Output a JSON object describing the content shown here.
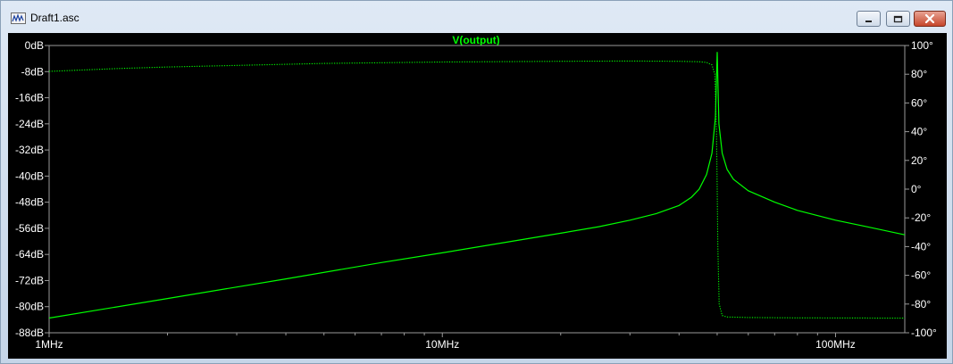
{
  "window": {
    "title": "Draft1.asc"
  },
  "colors": {
    "trace": "#00ff00",
    "background": "#000000",
    "text": "#ffffff"
  },
  "icons": {
    "app": "waveform-icon",
    "minimize": "minimize-icon",
    "maximize": "maximize-icon",
    "close": "close-icon"
  },
  "chart_data": {
    "type": "line",
    "title": "V(output)",
    "x_scale": "log",
    "x_unit": "Hz",
    "xlim": [
      1000000,
      150000000
    ],
    "x_ticks": [
      {
        "value": 1000000,
        "label": "1MHz"
      },
      {
        "value": 10000000,
        "label": "10MHz"
      },
      {
        "value": 100000000,
        "label": "100MHz"
      }
    ],
    "y_left": {
      "lim": [
        -88,
        0
      ],
      "tick_step": 8,
      "ticks": [
        "0dB",
        "-8dB",
        "-16dB",
        "-24dB",
        "-32dB",
        "-40dB",
        "-48dB",
        "-56dB",
        "-64dB",
        "-72dB",
        "-80dB",
        "-88dB"
      ]
    },
    "y_right": {
      "lim": [
        -100,
        100
      ],
      "tick_step": 20,
      "ticks": [
        "100°",
        "80°",
        "60°",
        "40°",
        "20°",
        "0°",
        "-20°",
        "-40°",
        "-60°",
        "-80°",
        "-100°"
      ]
    },
    "grid": false,
    "series": [
      {
        "axis": "left",
        "line_style": "solid",
        "x": [
          1000000,
          2000000,
          4000000,
          7000000,
          10000000,
          15000000,
          20000000,
          25000000,
          30000000,
          35000000,
          40000000,
          43000000,
          45000000,
          47000000,
          48500000,
          49500000,
          50000000,
          50500000,
          51500000,
          53000000,
          55000000,
          60000000,
          70000000,
          80000000,
          100000000,
          120000000,
          150000000
        ],
        "y": [
          -83.5,
          -77.5,
          -71.5,
          -66.5,
          -63.5,
          -60,
          -57.5,
          -55.5,
          -53.5,
          -51.5,
          -49,
          -46.5,
          -44,
          -39.5,
          -33,
          -22,
          -2,
          -24,
          -33,
          -38,
          -41,
          -44.5,
          -48,
          -50.5,
          -53.5,
          -55.5,
          -58
        ]
      },
      {
        "axis": "right",
        "line_style": "dotted",
        "x": [
          1000000,
          1500000,
          2000000,
          5000000,
          10000000,
          20000000,
          30000000,
          40000000,
          45000000,
          47000000,
          48500000,
          49300000,
          49800000,
          50000000,
          50200000,
          50600000,
          51500000,
          53000000,
          60000000,
          80000000,
          100000000,
          150000000
        ],
        "y": [
          82,
          84,
          85,
          87.5,
          88.5,
          89,
          89.2,
          89,
          88.7,
          88.2,
          86.5,
          80,
          40,
          0,
          -40,
          -80,
          -88,
          -89,
          -89.4,
          -89.6,
          -89.7,
          -89.8
        ]
      }
    ]
  }
}
